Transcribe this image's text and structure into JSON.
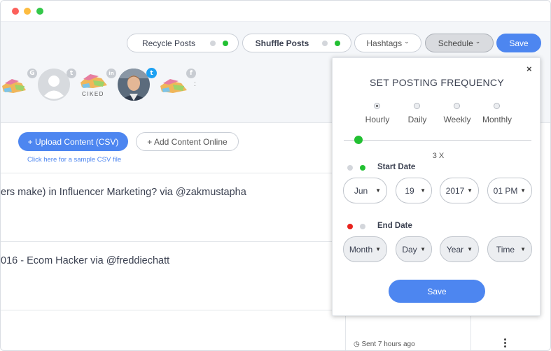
{
  "window": {
    "controls": [
      "close",
      "minimize",
      "maximize"
    ],
    "colors": {
      "close": "#fc605b",
      "minimize": "#fdbc40",
      "maximize": "#34c84a"
    }
  },
  "toolbar": {
    "recycle_label": "Recycle Posts",
    "shuffle_label": "Shuffle Posts",
    "hashtags_label": "Hashtags",
    "schedule_label": "Schedule",
    "save_label": "Save",
    "chevron": "⌄"
  },
  "accounts": [
    {
      "name": "google-account",
      "network": "google-icon",
      "badge": "G"
    },
    {
      "name": "twitter-account-1",
      "network": "twitter-icon",
      "badge": "t"
    },
    {
      "name": "linkedin-account",
      "network": "linkedin-icon",
      "badge": "in",
      "logo_text": "CIKED"
    },
    {
      "name": "twitter-account-2",
      "network": "twitter-icon",
      "badge": "t",
      "selected": true
    },
    {
      "name": "facebook-account",
      "network": "facebook-icon",
      "badge": "f"
    }
  ],
  "content": {
    "upload_label": "+ Upload Content (CSV)",
    "add_label": "+ Add Content Online",
    "csv_link": "Click here for a sample CSV file",
    "posts": [
      {
        "title": "ers make) in Influencer Marketing? via @zakmustapha"
      },
      {
        "title": "016 - Ecom Hacker via @freddiechatt"
      }
    ],
    "sent_label": "Sent 7 hours ago"
  },
  "popup": {
    "title": "SET POSTING FREQUENCY",
    "close": "×",
    "frequencies": [
      {
        "label": "Hourly",
        "selected": true
      },
      {
        "label": "Daily",
        "selected": false
      },
      {
        "label": "Weekly",
        "selected": false
      },
      {
        "label": "Monthly",
        "selected": false
      }
    ],
    "slider_value": "3 X",
    "start_label": "Start Date",
    "end_label": "End Date",
    "start": {
      "month": "Jun",
      "day": "19",
      "year": "2017",
      "time": "01 PM"
    },
    "end": {
      "month": "Month",
      "day": "Day",
      "year": "Year",
      "time": "Time"
    },
    "caret": "▼",
    "save_label": "Save"
  }
}
